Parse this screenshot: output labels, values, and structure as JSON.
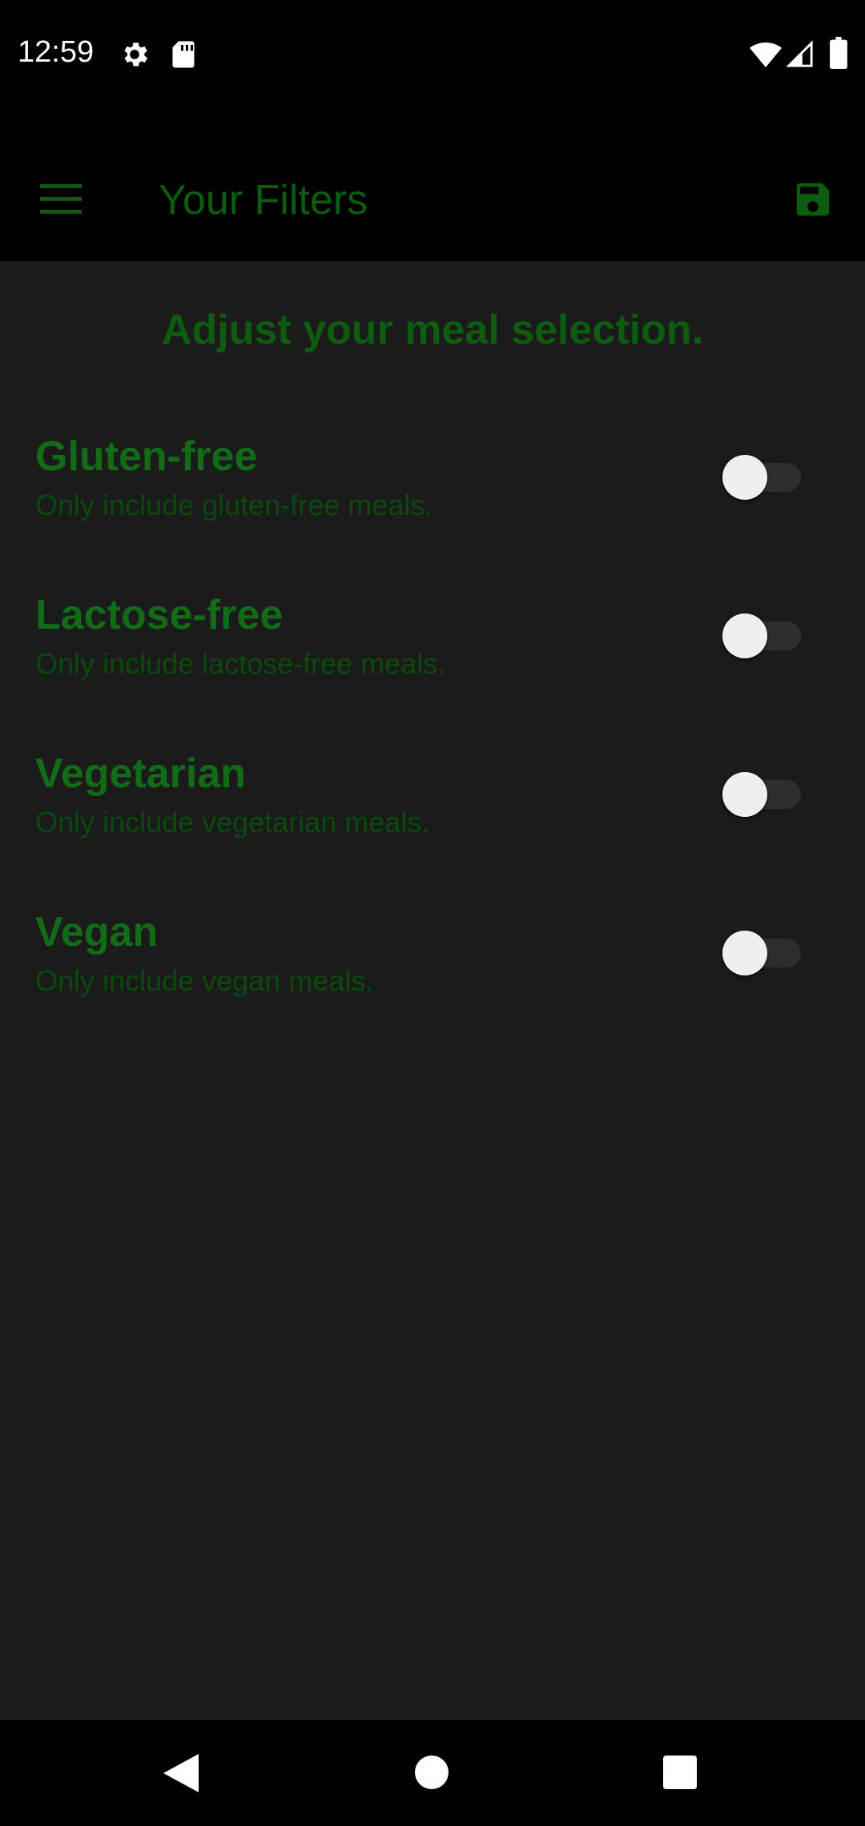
{
  "status_bar": {
    "time": "12:59",
    "icons": [
      "gear-icon",
      "sd-card-icon",
      "wifi-icon",
      "signal-icon",
      "battery-icon"
    ]
  },
  "app_bar": {
    "title": "Your Filters",
    "menu_icon": "menu-icon",
    "save_icon": "save-icon"
  },
  "main": {
    "heading": "Adjust your meal selection.",
    "filters": [
      {
        "title": "Gluten-free",
        "subtitle": "Only include gluten-free meals.",
        "enabled": false
      },
      {
        "title": "Lactose-free",
        "subtitle": "Only include lactose-free meals.",
        "enabled": false
      },
      {
        "title": "Vegetarian",
        "subtitle": "Only include vegetarian meals.",
        "enabled": false
      },
      {
        "title": "Vegan",
        "subtitle": "Only include vegan meals.",
        "enabled": false
      }
    ]
  },
  "nav_bar": {
    "icons": [
      "back-icon",
      "home-icon",
      "recents-icon"
    ]
  },
  "colors": {
    "accent_green": "#0d5c10",
    "title_green": "#126b16",
    "subtitle_green": "#0a4a0d",
    "background": "#1b1b1b",
    "bar_background": "#000000"
  }
}
